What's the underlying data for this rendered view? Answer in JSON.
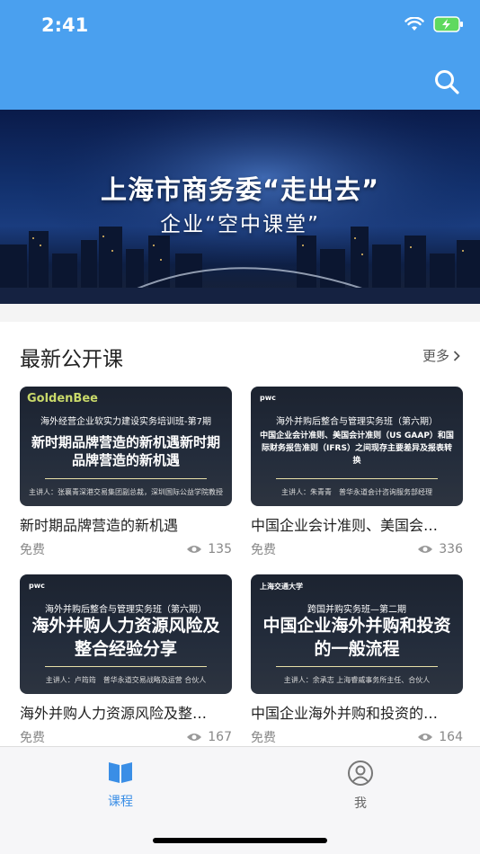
{
  "status_bar": {
    "time": "2:41"
  },
  "banner": {
    "title": "上海市商务委“走出去”",
    "subtitle": "企业“空中课堂”"
  },
  "section": {
    "title": "最新公开课",
    "more": "更多"
  },
  "courses": [
    {
      "logo": "GoldenBee",
      "thumb_header": "海外经营企业软实力建设实务培训班-第7期",
      "thumb_main": "新时期品牌营造的新机遇新时期品牌营造的新机遇",
      "thumb_footer": "主讲人：张襄青深港交易集团副总裁，深圳国际公益学院教授",
      "title": "新时期品牌营造的新机遇",
      "price": "免费",
      "views": "135"
    },
    {
      "logo": "pwc",
      "thumb_header": "海外并购后整合与管理实务班（第六期）",
      "thumb_main": "中国企业会计准则、美国会计准则（US GAAP）和国际财务报告准则（IFRS）之间现存主要差异及报表转换",
      "thumb_footer": "主讲人：朱青青　普华永道会计咨询服务部经理",
      "title": "中国企业会计准则、美国会…",
      "price": "免费",
      "views": "336"
    },
    {
      "logo": "pwc",
      "thumb_header": "海外并购后整合与管理实务班（第六期）",
      "thumb_main": "海外并购人力资源风险及整合经验分享",
      "thumb_footer": "主讲人：卢筠筠　普华永道交易战略及运营 合伙人",
      "title": "海外并购人力资源风险及整…",
      "price": "免费",
      "views": "167"
    },
    {
      "logo": "上海交通大学",
      "thumb_header": "跨国并购实务班—第二期",
      "thumb_main": "中国企业海外并购和投资的一般流程",
      "thumb_footer": "主讲人：余承志 上海睿威事务所主任、合伙人",
      "title": "中国企业海外并购和投资的…",
      "price": "免费",
      "views": "164"
    }
  ],
  "tabs": [
    {
      "label": "课程",
      "icon": "book-icon",
      "active": true
    },
    {
      "label": "我",
      "icon": "user-icon",
      "active": false
    }
  ],
  "colors": {
    "primary": "#4aa0ef",
    "tab_active": "#3a8ee6",
    "tab_inactive": "#666666"
  }
}
